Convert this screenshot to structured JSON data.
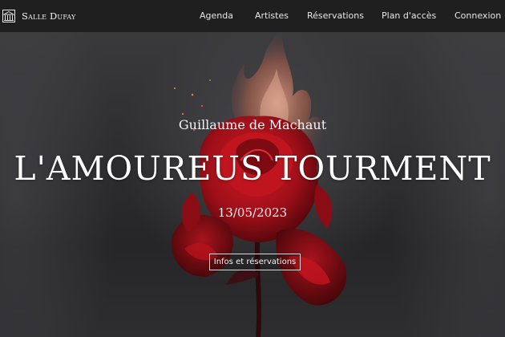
{
  "header": {
    "brand_name": "Salle Dufay",
    "logo_icon": "building-columns-icon",
    "nav": [
      {
        "label": "Agenda"
      },
      {
        "label": "Artistes"
      },
      {
        "label": "Réservations"
      },
      {
        "label": "Plan d'accès"
      },
      {
        "label": "Connexion"
      }
    ]
  },
  "hero": {
    "composer": "Guillaume de Machaut",
    "title": "L'AMOUREUS TOURMENT",
    "date": "13/05/2023",
    "cta_label": "Infos et réservations",
    "image": "burning-red-rose"
  },
  "colors": {
    "navbar_bg": "#1f1f20",
    "rose_red": "#b3121d",
    "flame": "#c8745a"
  }
}
